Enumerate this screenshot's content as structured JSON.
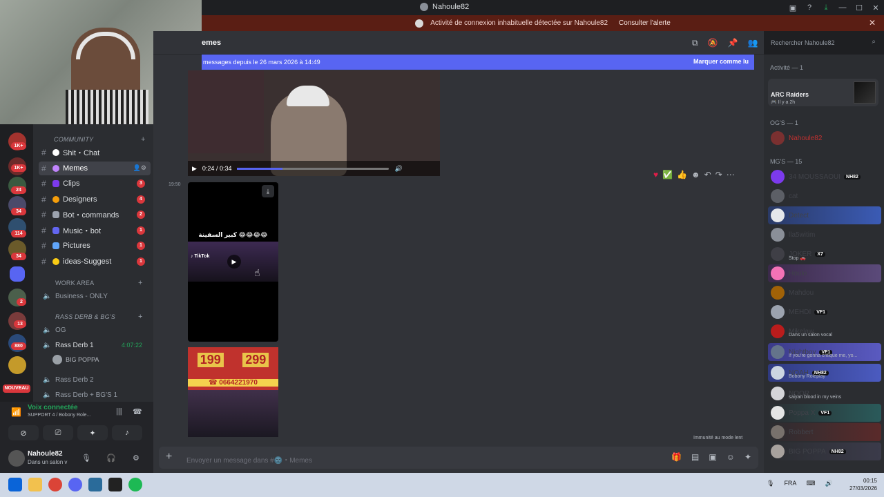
{
  "window": {
    "title": "Nahoule82",
    "controls": [
      "▣",
      "?",
      "⤓",
      "—",
      "☐",
      "✕"
    ]
  },
  "alert": {
    "text": "Activité de connexion inhabituelle détectée sur Nahoule82",
    "link": "Consulter l'alerte",
    "close": "✕"
  },
  "header": {
    "channel": "emes",
    "search_placeholder": "Rechercher Nahoule82"
  },
  "newmsgs": {
    "text": "messages depuis le 26 mars 2026 à 14:49",
    "mark": "Marquer comme lu"
  },
  "video": {
    "time": "0:24 / 0:34"
  },
  "message": {
    "timestamp": "19:50",
    "tiktok_caption": "كبير السفينة 😂😂😂😂",
    "tiktok_brand": "♪ TikTok"
  },
  "promo": {
    "price1": "199",
    "price2": "299",
    "phone": "☎ 0664221970"
  },
  "sidebar": {
    "cat_community": "COMMUNITY",
    "channels": [
      {
        "label": "Shit・Chat",
        "count": ""
      },
      {
        "label": "Memes",
        "count": ""
      },
      {
        "label": "Clips",
        "count": "3"
      },
      {
        "label": "Designers",
        "count": "4"
      },
      {
        "label": "Bot・commands",
        "count": "2"
      },
      {
        "label": "Music・bot",
        "count": "1"
      },
      {
        "label": "Pictures",
        "count": "1"
      },
      {
        "label": "ideas-Suggest",
        "count": "1"
      }
    ],
    "cat_work": "WORK AREA",
    "business": "Business - ONLY",
    "cat_rass": "RASS DERB & BG'S",
    "voice": [
      {
        "label": "OG",
        "time": ""
      },
      {
        "label": "Rass Derb 1",
        "time": "4:07:22"
      },
      {
        "label": "Rass Derb 2",
        "time": ""
      },
      {
        "label": "Rass Derb + BG'S 1",
        "time": ""
      }
    ],
    "voice_user": "BIG POPPA"
  },
  "rail": {
    "badges": [
      "1K+",
      "1K+",
      "24",
      "34",
      "114",
      "34",
      "2",
      "13",
      "880"
    ],
    "new": "NOUVEAU"
  },
  "voicebar": {
    "title": "Voix connectée",
    "subtitle": "SUPPORT 4 / Bobony Role..."
  },
  "user": {
    "name": "Nahoule82",
    "status": "Dans un salon v"
  },
  "composer": {
    "placeholder": "Envoyer un message dans #🌚・Memes",
    "slowmode": "Immunité au mode lent"
  },
  "members": {
    "activity_header": "Activité — 1",
    "activity_game": "ARC Raiders",
    "activity_ago": "🎮 Il y a 2h",
    "og_header": "OG'S — 1",
    "og_member": "Nahoule82",
    "mg_header": "MG'S — 15",
    "list": [
      {
        "name": "34 MOUSSAOUI",
        "tag": "NH82",
        "status": ""
      },
      {
        "name": "cat",
        "tag": "",
        "status": ""
      },
      {
        "name": "Detect",
        "tag": "",
        "status": ""
      },
      {
        "name": "lla5witim",
        "tag": "",
        "status": ""
      },
      {
        "name": "JOKER",
        "tag": "X7",
        "status": "Stop 🚗"
      },
      {
        "name": "Houlo",
        "tag": "",
        "status": ""
      },
      {
        "name": "Mahdou",
        "tag": "",
        "status": ""
      },
      {
        "name": "MEHDI",
        "tag": "VF1",
        "status": ""
      },
      {
        "name": "Mikelaw",
        "tag": "",
        "status": "Dans un salon vocal"
      },
      {
        "name": "Nightboy",
        "tag": "VF1",
        "status": "If you're gonna critique me, yo..."
      },
      {
        "name": "NOAH",
        "tag": "NH82",
        "status": "Bobony Roleplay"
      },
      {
        "name": "NOOR",
        "tag": "",
        "status": "saiyan blood in my veins"
      },
      {
        "name": "Poppa X",
        "tag": "VF1",
        "status": ""
      },
      {
        "name": "Robbert",
        "tag": "",
        "status": ""
      },
      {
        "name": "BIG POPPA",
        "tag": "NH82",
        "status": ""
      }
    ]
  },
  "taskbar": {
    "lang": "FRA",
    "time": "00:15",
    "date": "27/03/2026"
  }
}
